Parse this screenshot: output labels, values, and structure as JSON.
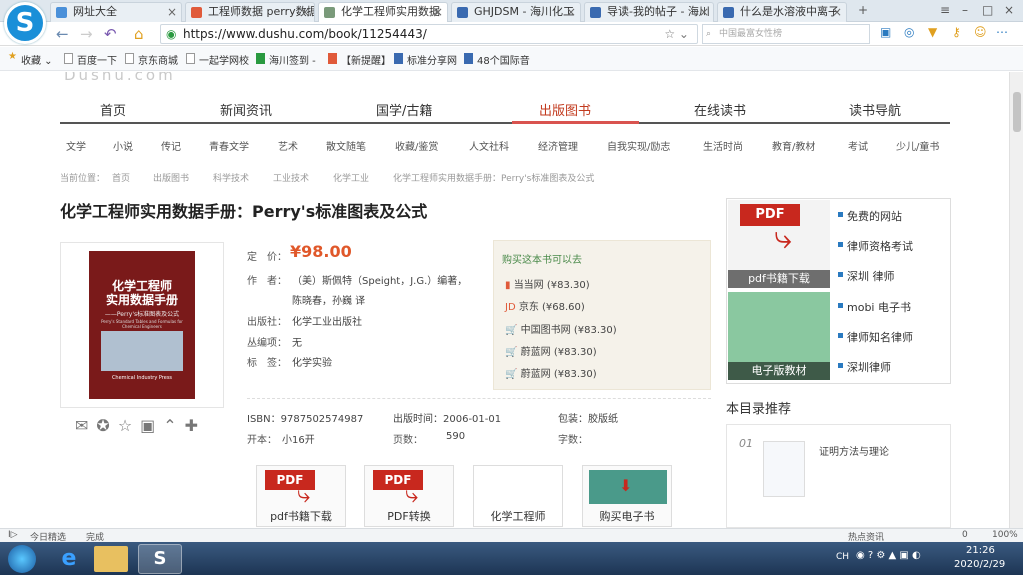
{
  "browser": {
    "tabs": [
      {
        "title": "网址大全",
        "active": false
      },
      {
        "title": "工程师数据 perry数据",
        "active": false
      },
      {
        "title": "化学工程师实用数据",
        "active": true
      },
      {
        "title": "GHJDSM - 海川化工",
        "active": false
      },
      {
        "title": "导读-我的帖子 - 海川",
        "active": false
      },
      {
        "title": "什么是水溶液中离子",
        "active": false
      }
    ],
    "url": "https://www.dushu.com/book/11254443/",
    "search_placeholder": "中国最富女性榜",
    "bookmarks": [
      "收藏",
      "百度一下",
      "京东商城",
      "一起学网校",
      "海川签到 -",
      "【新提醒】",
      "标准分享网",
      "48个国际音"
    ]
  },
  "site": {
    "logo_text": "Dushu.com",
    "main_nav": [
      "首页",
      "新闻资讯",
      "国学/古籍",
      "出版图书",
      "在线读书",
      "读书导航"
    ],
    "active_nav": "出版图书",
    "sub_nav": [
      "文学",
      "小说",
      "传记",
      "青春文学",
      "艺术",
      "散文随笔",
      "收藏/鉴赏",
      "人文社科",
      "经济管理",
      "自我实现/励志",
      "生活时尚",
      "教育/教材",
      "考试",
      "少儿/童书"
    ],
    "breadcrumb": [
      "当前位置：",
      "首页",
      "出版图书",
      "科学技术",
      "工业技术",
      "化学工业",
      "化学工程师实用数据手册：Perry's标准图表及公式"
    ]
  },
  "book": {
    "title": "化学工程师实用数据手册：Perry's标准图表及公式",
    "cover_lines": [
      "化学工程师",
      "实用数据手册",
      "——Perry's标准图表及公式"
    ],
    "cover_sub": "Perry's Standard Tables and Formulas for Chemical Engineers",
    "cover_publisher": "Chemical Industry Press",
    "price_label": "定　价：",
    "price": "¥98.00",
    "author_label": "作　者：",
    "author_line1": "（美）斯佩特（Speight，J.G.）编著，",
    "author_line2": "陈晓春，孙巍 译",
    "publisher_label": "出版社：",
    "publisher": "化学工业出版社",
    "series_label": "丛编项：",
    "series": "无",
    "tag_label": "标　签：",
    "tag": "化学实验",
    "isbn": "ISBN：9787502574987",
    "pubtime": "出版时间：2006-01-01",
    "binding": "包装：胶版纸",
    "format_label": "开本：",
    "format": "小16开",
    "pages_label": "页数：",
    "pages": "590",
    "words": "字数："
  },
  "buy": {
    "title": "购买这本书可以去",
    "shops": [
      {
        "name": "当当网",
        "price": "(¥83.30)"
      },
      {
        "name": "京东",
        "price": "(¥68.60)"
      },
      {
        "name": "中国图书网",
        "price": "(¥83.30)"
      },
      {
        "name": "蔚蓝网",
        "price": "(¥83.30)"
      },
      {
        "name": "蔚蓝网",
        "price": "(¥83.30)"
      }
    ]
  },
  "sidebar": {
    "ad_tiles": [
      "pdf书籍下载",
      "电子版教材"
    ],
    "ad_links": [
      "免费的网站",
      "律师资格考试",
      "深圳 律师",
      "mobi 电子书",
      "律师知名律师",
      "深圳律师"
    ],
    "recommend_title": "本目录推荐",
    "rec_index": "01",
    "rec_item": "证明方法与理论"
  },
  "bottom_ads": [
    "pdf书籍下载",
    "PDF转换",
    "化学工程师",
    "购买电子书"
  ],
  "status": {
    "left": "今日精选",
    "done": "完成",
    "hot": "热点资讯",
    "zoom": "100%",
    "count": "0"
  },
  "taskbar": {
    "time": "21:26",
    "date": "2020/2/29",
    "lang": "CH"
  },
  "colors": {
    "accent": "#c23a1e",
    "nav_line": "#d9534f"
  }
}
